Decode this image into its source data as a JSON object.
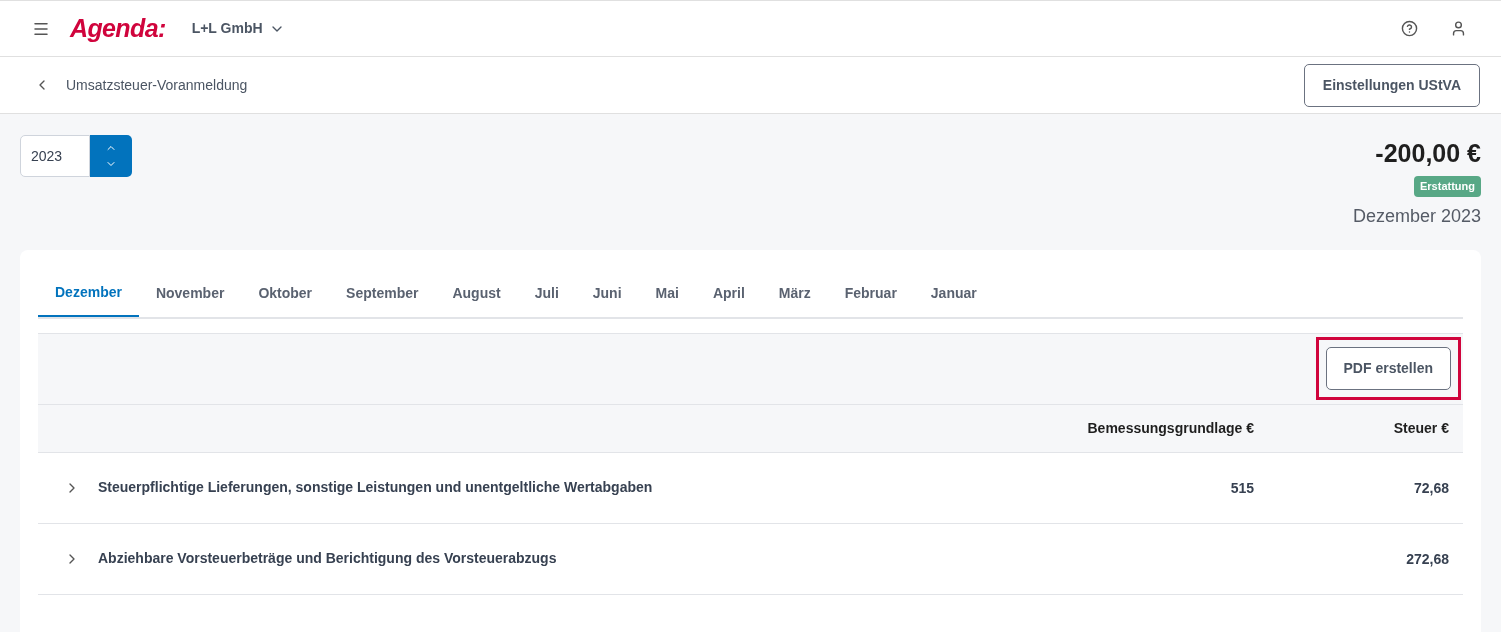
{
  "header": {
    "logo": "Agenda:",
    "company": "L+L GmbH"
  },
  "subheader": {
    "title": "Umsatzsteuer-Voranmeldung",
    "settings_button": "Einstellungen UStVA"
  },
  "year_field": {
    "value": "2023"
  },
  "summary": {
    "amount": "-200,00 €",
    "badge": "Erstattung",
    "period": "Dezember 2023"
  },
  "tabs": [
    {
      "label": "Dezember",
      "selected": true
    },
    {
      "label": "November",
      "selected": false
    },
    {
      "label": "Oktober",
      "selected": false
    },
    {
      "label": "September",
      "selected": false
    },
    {
      "label": "August",
      "selected": false
    },
    {
      "label": "Juli",
      "selected": false
    },
    {
      "label": "Juni",
      "selected": false
    },
    {
      "label": "Mai",
      "selected": false
    },
    {
      "label": "April",
      "selected": false
    },
    {
      "label": "März",
      "selected": false
    },
    {
      "label": "Februar",
      "selected": false
    },
    {
      "label": "Januar",
      "selected": false
    }
  ],
  "pdf_button": {
    "label": "PDF erstellen",
    "highlighted": true
  },
  "table": {
    "columns": [
      "Bemessungsgrundlage €",
      "Steuer €"
    ],
    "rows": [
      {
        "label": "Steuerpflichtige Lieferungen, sonstige Leistungen und unentgeltliche Wertabgaben",
        "expanded": false,
        "basis": "515",
        "tax": "72,68"
      },
      {
        "label": "Abziehbare Vorsteuerbeträge und Berichtigung des Vorsteuerabzugs",
        "expanded": false,
        "basis": "",
        "tax": "272,68"
      }
    ]
  }
}
